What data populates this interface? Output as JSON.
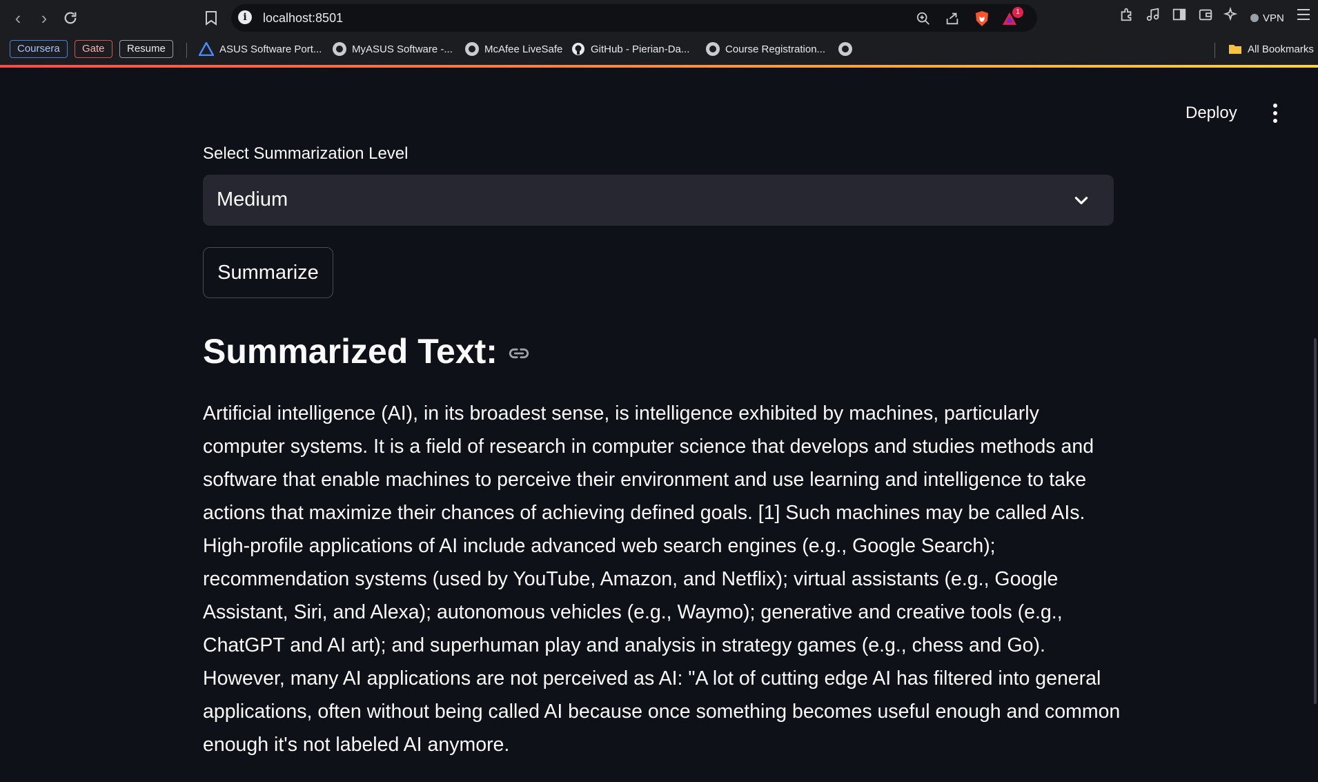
{
  "browser": {
    "url": "localhost:8501",
    "notification_count": "1",
    "vpn_label": "VPN",
    "bookmarks_tags": [
      "Coursera",
      "Gate",
      "Resume"
    ],
    "bookmarks": [
      "ASUS Software Port...",
      "MyASUS Software -...",
      "McAfee LiveSafe",
      "GitHub - Pierian-Da...",
      "Course Registration..."
    ],
    "all_bookmarks_label": "All Bookmarks"
  },
  "app": {
    "deploy_label": "Deploy",
    "select_label": "Select Summarization Level",
    "select_value": "Medium",
    "summarize_button": "Summarize",
    "heading": "Summarized Text:",
    "summary": "Artificial intelligence (AI), in its broadest sense, is intelligence exhibited by machines, particularly computer systems. It is a field of research in computer science that develops and studies methods and software that enable machines to perceive their environment and use learning and intelligence to take actions that maximize their chances of achieving defined goals. [1] Such machines may be called AIs. High-profile applications of AI include advanced web search engines (e.g., Google Search); recommendation systems (used by YouTube, Amazon, and Netflix); virtual assistants (e.g., Google Assistant, Siri, and Alexa); autonomous vehicles (e.g., Waymo); generative and creative tools (e.g., ChatGPT and AI art); and superhuman play and analysis in strategy games (e.g., chess and Go). However, many AI applications are not perceived as AI: \"A lot of cutting edge AI has filtered into general applications, often without being called AI because once something becomes useful enough and common enough it's not labeled AI anymore."
  },
  "colors": {
    "background": "#0e1117",
    "surface": "#262730",
    "text": "#fafafa",
    "accent": "#ff4b4b"
  }
}
